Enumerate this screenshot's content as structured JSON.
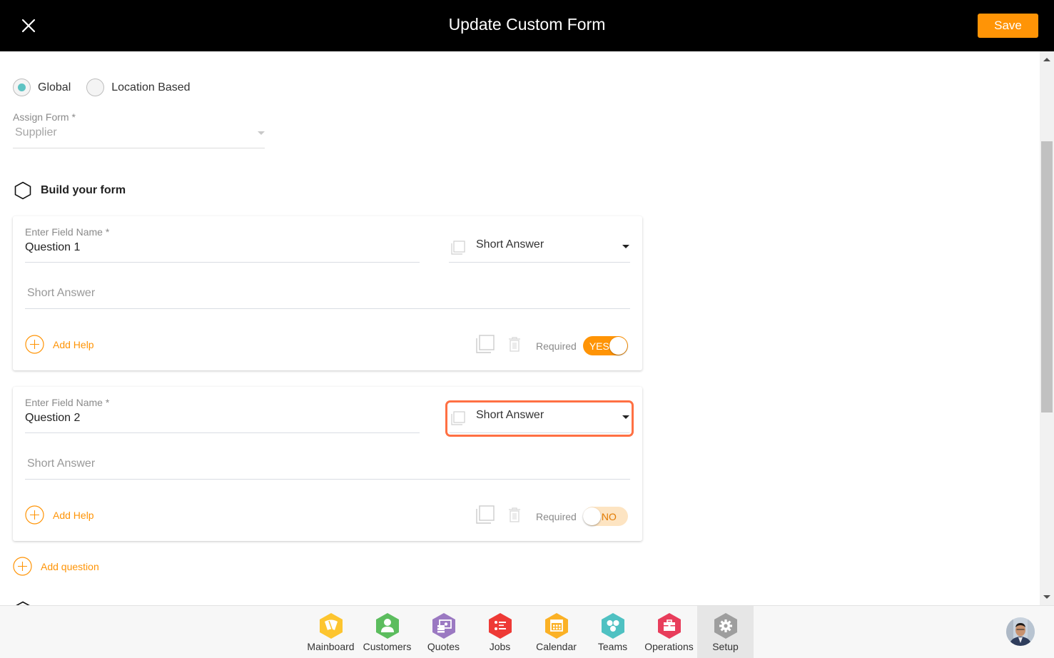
{
  "header": {
    "title": "Update Custom Form",
    "save_label": "Save",
    "close_icon": "close-icon"
  },
  "scope": {
    "options": [
      {
        "label": "Global",
        "selected": true
      },
      {
        "label": "Location Based",
        "selected": false
      }
    ]
  },
  "assign_form": {
    "label": "Assign Form *",
    "value": "Supplier"
  },
  "build_section": {
    "title": "Build your form",
    "icon": "hexagon-icon"
  },
  "questions": [
    {
      "field_label": "Enter Field Name *",
      "field_value": "Question 1",
      "type_value": "Short Answer",
      "answer_placeholder": "Short Answer",
      "add_help_label": "Add Help",
      "required_label": "Required",
      "required": true,
      "toggle_text": "YES",
      "type_focused": false
    },
    {
      "field_label": "Enter Field Name *",
      "field_value": "Question 2",
      "type_value": "Short Answer",
      "answer_placeholder": "Short Answer",
      "add_help_label": "Add Help",
      "required_label": "Required",
      "required": false,
      "toggle_text": "NO",
      "type_focused": true
    }
  ],
  "add_question_label": "Add question",
  "bottom_nav": {
    "items": [
      {
        "label": "Mainboard",
        "icon": "mainboard-icon",
        "color": "#fdc52f",
        "active": false
      },
      {
        "label": "Customers",
        "icon": "customer-icon",
        "color": "#5cbd5e",
        "active": false
      },
      {
        "label": "Quotes",
        "icon": "quotes-icon",
        "color": "#9b79c2",
        "active": false
      },
      {
        "label": "Jobs",
        "icon": "jobs-icon",
        "color": "#ee3a36",
        "active": false
      },
      {
        "label": "Calendar",
        "icon": "calendar-icon",
        "color": "#fbb125",
        "active": false
      },
      {
        "label": "Teams",
        "icon": "teams-icon",
        "color": "#4fc1c2",
        "active": false
      },
      {
        "label": "Operations",
        "icon": "operations-icon",
        "color": "#e83d5b",
        "active": false
      },
      {
        "label": "Setup",
        "icon": "gear-icon",
        "color": "#9e9e9e",
        "active": true
      }
    ]
  },
  "colors": {
    "accent": "#ff9406",
    "radio_checked": "#5ec3c3",
    "focus_outline": "#ff7043"
  }
}
